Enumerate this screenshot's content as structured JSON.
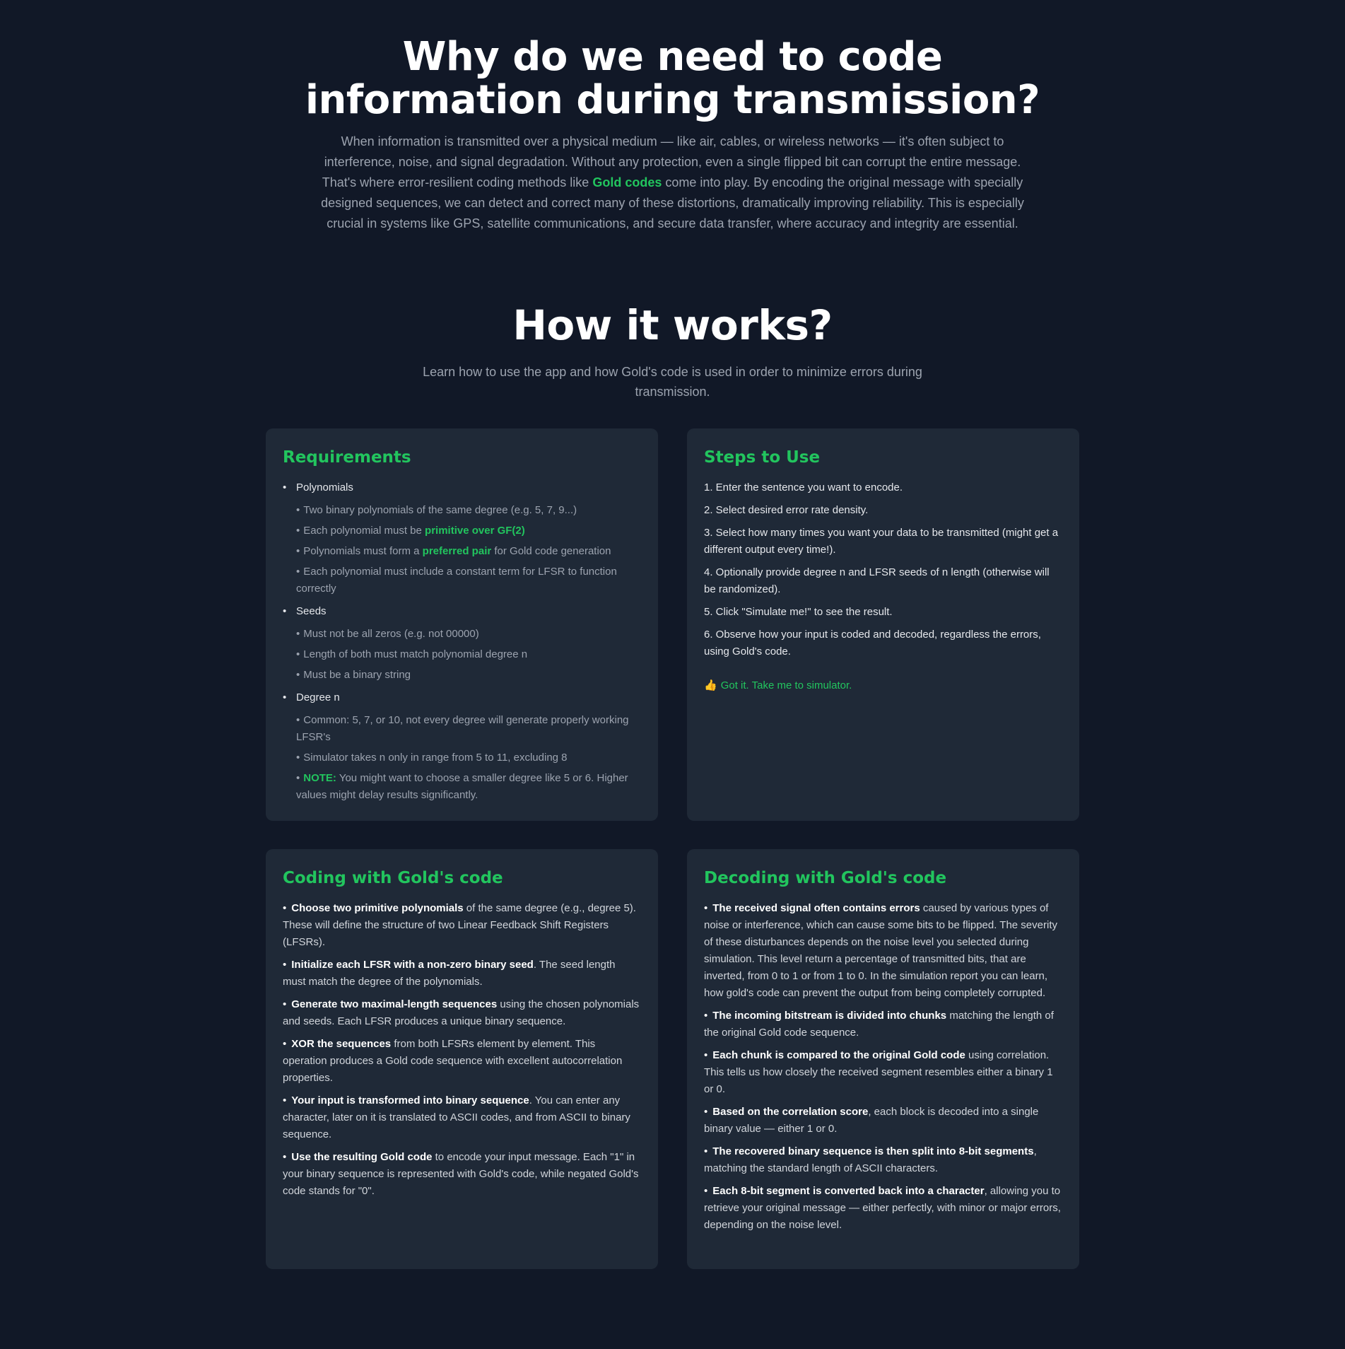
{
  "hero": {
    "title": "Why do we need to code information during transmission?",
    "p_before": "When information is transmitted over a physical medium — like air, cables, or wireless networks — it's often subject to interference, noise, and signal degradation. Without any protection, even a single flipped bit can corrupt the entire message. That's where error-resilient coding methods like ",
    "p_highlight": "Gold codes",
    "p_after": " come into play. By encoding the original message with specially designed sequences, we can detect and correct many of these distortions, dramatically improving reliability. This is especially crucial in systems like GPS, satellite communications, and secure data transfer, where accuracy and integrity are essential."
  },
  "how": {
    "title": "How it works?",
    "subtitle": "Learn how to use the app and how Gold's code is used in order to minimize errors during transmission."
  },
  "requirements": {
    "title": "Requirements",
    "polynomials": "Polynomials",
    "poly_1": "Two binary polynomials of the same degree (e.g. 5, 7, 9...)",
    "poly_2_pre": "Each polynomial must be ",
    "poly_2_hl": "primitive over GF(2)",
    "poly_3_pre": "Polynomials must form a ",
    "poly_3_hl": "preferred pair",
    "poly_3_post": " for Gold code generation",
    "poly_4": "Each polynomial must include a constant term for LFSR to function correctly",
    "seeds": "Seeds",
    "seed_1": "Must not be all zeros (e.g. not 00000)",
    "seed_2": "Length of both must match polynomial degree n",
    "seed_3": "Must be a binary string",
    "degree": "Degree n",
    "deg_1": "Common: 5, 7, or 10, not every degree will generate properly working LFSR's",
    "deg_2": "Simulator takes n only in range from 5 to 11, excluding 8",
    "deg_3_hl": "NOTE:",
    "deg_3_post": " You might want to choose a smaller degree like 5 or 6. Higher values might delay results significantly."
  },
  "steps": {
    "title": "Steps to Use",
    "s1": "1. Enter the sentence you want to encode.",
    "s2": "2. Select desired error rate density.",
    "s3": "3. Select how many times you want your data to be transmitted (might get a different output every time!).",
    "s4": "4. Optionally provide degree n and LFSR seeds of n length (otherwise will be randomized).",
    "s5": "5. Click \"Simulate me!\" to see the result.",
    "s6": "6. Observe how your input is coded and decoded, regardless the errors, using Gold's code.",
    "cta_icon": "👍",
    "cta": "Got it. Take me to simulator."
  },
  "coding": {
    "title": "Coding with Gold's code",
    "i1_b": "Choose two primitive polynomials",
    "i1_t": " of the same degree (e.g., degree 5). These will define the structure of two Linear Feedback Shift Registers (LFSRs).",
    "i2_b": "Initialize each LFSR with a non-zero binary seed",
    "i2_t": ". The seed length must match the degree of the polynomials.",
    "i3_b": "Generate two maximal-length sequences",
    "i3_t": " using the chosen polynomials and seeds. Each LFSR produces a unique binary sequence.",
    "i4_b": "XOR the sequences",
    "i4_t": " from both LFSRs element by element. This operation produces a Gold code sequence with excellent autocorrelation properties.",
    "i5_b": "Your input is transformed into binary sequence",
    "i5_t": ". You can enter any character, later on it is translated to ASCII codes, and from ASCII to binary sequence.",
    "i6_b": "Use the resulting Gold code",
    "i6_t": " to encode your input message. Each \"1\" in your binary sequence is represented with Gold's code, while negated Gold's code stands for \"0\"."
  },
  "decoding": {
    "title": "Decoding with Gold's code",
    "i1_b": "The received signal often contains errors",
    "i1_t": " caused by various types of noise or interference, which can cause some bits to be flipped. The severity of these disturbances depends on the noise level you selected during simulation. This level return a percentage of transmitted bits, that are inverted, from 0 to 1 or from 1 to 0. In the simulation report you can learn, how gold's code can prevent the output from being completely corrupted.",
    "i2_b": "The incoming bitstream is divided into chunks",
    "i2_t": " matching the length of the original Gold code sequence.",
    "i3_b": "Each chunk is compared to the original Gold code",
    "i3_t": " using correlation. This tells us how closely the received segment resembles either a binary 1 or 0.",
    "i4_b": "Based on the correlation score",
    "i4_t": ", each block is decoded into a single binary value — either 1 or 0.",
    "i5_b": "The recovered binary sequence is then split into 8-bit segments",
    "i5_t": ", matching the standard length of ASCII characters.",
    "i6_b": "Each 8-bit segment is converted back into a character",
    "i6_t": ", allowing you to retrieve your original message — either perfectly, with minor or major errors, depending on the noise level."
  }
}
